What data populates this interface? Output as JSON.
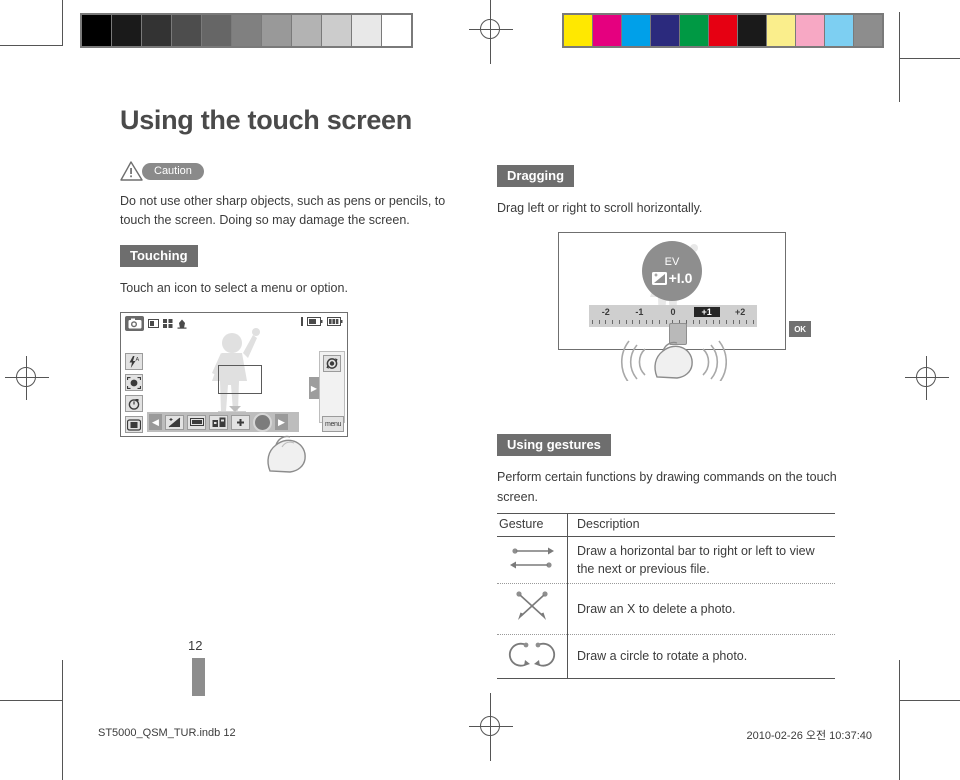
{
  "document": {
    "title": "Using the touch screen",
    "page_number": "12"
  },
  "caution": {
    "label": "Caution",
    "icon": "warning-triangle-icon",
    "text": "Do not use other sharp objects, such as pens or pencils, to touch the screen. Doing so may damage the screen."
  },
  "sections": {
    "touching": {
      "label": "Touching",
      "text": "Touch an icon to select a menu or option."
    },
    "dragging": {
      "label": "Dragging",
      "text": "Drag left or right to scroll horizontally."
    },
    "gestures": {
      "label": "Using gestures",
      "text": "Perform certain functions by drawing commands on the touch screen."
    }
  },
  "camera_screen": {
    "mode_icon": "camera-mode-icon",
    "status_icons": [
      "photo-size-icon",
      "quality-grid-icon",
      "metering-icon"
    ],
    "top_right_icons": [
      "memory-icon",
      "battery-icon"
    ],
    "left_icons": [
      "flash-auto-icon",
      "face-detection-icon",
      "self-timer-icon",
      "image-stabilizer-icon"
    ],
    "right_panel_icon": "camera-rotate-icon",
    "bottom_icons": [
      "chevron-left-icon",
      "ev-icon",
      "white-balance-icon",
      "iso-icon",
      "plus-icon",
      "shutter-button",
      "chevron-right-icon"
    ],
    "menu_label": "menu",
    "focus_box": "focus-frame",
    "finger": "finger-tap-cursor"
  },
  "ev_screen": {
    "bubble_label": "EV",
    "bubble_icon": "exposure-icon",
    "bubble_value": "+I.0",
    "scale_values": [
      "-2",
      "-1",
      "0",
      "+1",
      "+2"
    ],
    "selected_value": "+1",
    "ok_label": "OK",
    "finger": "finger-drag-cursor"
  },
  "gestures_table": {
    "headers": [
      "Gesture",
      "Description"
    ],
    "rows": [
      {
        "icon": "horizontal-bar-gesture-icon",
        "description": "Draw a horizontal bar to right or left to view the next or previous file."
      },
      {
        "icon": "x-gesture-icon",
        "description": "Draw an X to delete a photo."
      },
      {
        "icon": "circle-gesture-icon",
        "description": "Draw a circle to rotate a photo."
      }
    ]
  },
  "footer": {
    "file_name": "ST5000_QSM_TUR.indb   12",
    "timestamp": "2010-02-26   오전 10:37:40"
  },
  "print_marks": {
    "grayscale_swatches": [
      "#000000",
      "#1a1a1a",
      "#333333",
      "#4d4d4d",
      "#666666",
      "#808080",
      "#999999",
      "#b3b3b3",
      "#cccccc",
      "#e8e8e8",
      "#ffffff"
    ],
    "color_swatches": [
      "#ffe800",
      "#e5007f",
      "#00a0e9",
      "#2b2a7d",
      "#009944",
      "#e60012",
      "#1a1a1a",
      "#faee8c",
      "#f7a8c4",
      "#7dcff2",
      "#8d8d8d"
    ]
  },
  "colors": {
    "label_bg": "#6e6e6e",
    "caution_bg": "#8a8a8a",
    "text": "#3b3b3b",
    "title": "#4a4a4a"
  }
}
